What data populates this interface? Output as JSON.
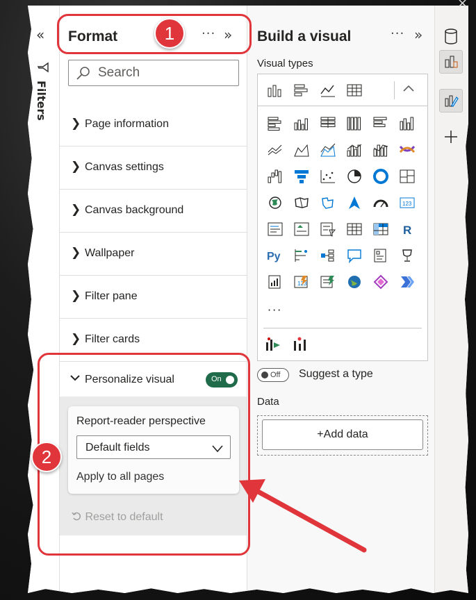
{
  "filters": {
    "label": "Filters",
    "collapse_glyph": "«"
  },
  "format": {
    "title": "Format",
    "more": "···",
    "collapse_glyph": "»",
    "search_placeholder": "Search",
    "sections": [
      {
        "label": "Page information"
      },
      {
        "label": "Canvas settings"
      },
      {
        "label": "Canvas background"
      },
      {
        "label": "Wallpaper"
      },
      {
        "label": "Filter pane"
      },
      {
        "label": "Filter cards"
      }
    ],
    "personalize": {
      "label": "Personalize visual",
      "toggle": "On",
      "perspective_label": "Report-reader perspective",
      "perspective_value": "Default fields",
      "apply_all": "Apply to all pages",
      "reset": "Reset to default"
    }
  },
  "build": {
    "title": "Build a visual",
    "more": "···",
    "collapse_glyph": "»",
    "visual_types_label": "Visual types",
    "more_visuals": "···",
    "suggest_toggle": "Off",
    "suggest_label": "Suggest a type",
    "data_label": "Data",
    "add_data": "+Add data"
  },
  "callouts": {
    "one": "1",
    "two": "2"
  },
  "colors": {
    "accent": "#e0353b",
    "toggle_on": "#1f6b4a"
  },
  "icons": [
    "database-icon",
    "build-visual-icon",
    "format-visual-icon",
    "plus-icon"
  ]
}
